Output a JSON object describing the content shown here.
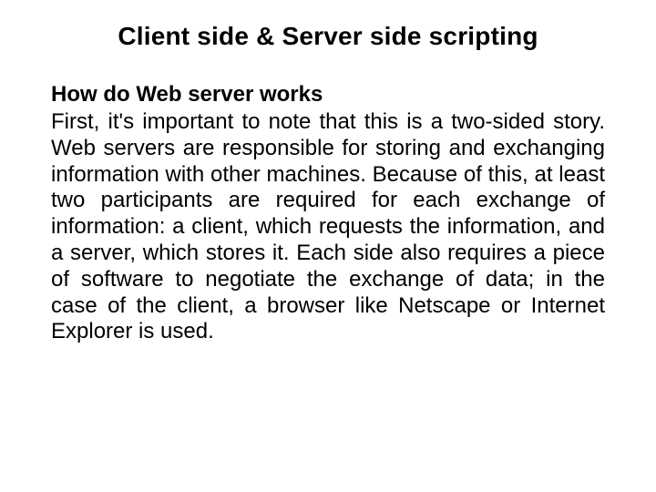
{
  "slide": {
    "title": "Client side & Server side scripting",
    "subheading": "How do Web server works",
    "body": "First, it's important to note that this is a two-sided story. Web servers are responsible for storing and exchanging information with other machines. Because of this, at least two participants are required for each exchange of information: a client, which requests the information, and a server, which stores it. Each side also requires a piece of software to negotiate the exchange of data; in the case of the client, a browser like Netscape or Internet Explorer is used."
  }
}
